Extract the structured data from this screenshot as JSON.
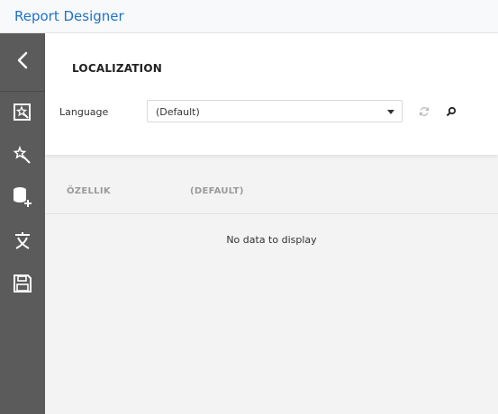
{
  "app": {
    "title": "Report Designer"
  },
  "sidebar": {
    "back_icon": "chevron-left-icon",
    "items": [
      {
        "icon": "report-wizard-icon"
      },
      {
        "icon": "magic-wand-icon"
      },
      {
        "icon": "add-data-source-icon"
      },
      {
        "icon": "localization-icon"
      },
      {
        "icon": "save-icon"
      }
    ]
  },
  "localization": {
    "title": "LOCALIZATION",
    "language_label": "Language",
    "language_value": "(Default)",
    "refresh_icon": "refresh-icon",
    "search_icon": "search-icon"
  },
  "grid": {
    "columns": [
      "ÖZELLIK",
      "(DEFAULT)"
    ],
    "empty_message": "No data to display"
  },
  "colors": {
    "accent": "#1f72c4",
    "sidebar": "#5b5b5b",
    "background": "#f3f3f3"
  }
}
